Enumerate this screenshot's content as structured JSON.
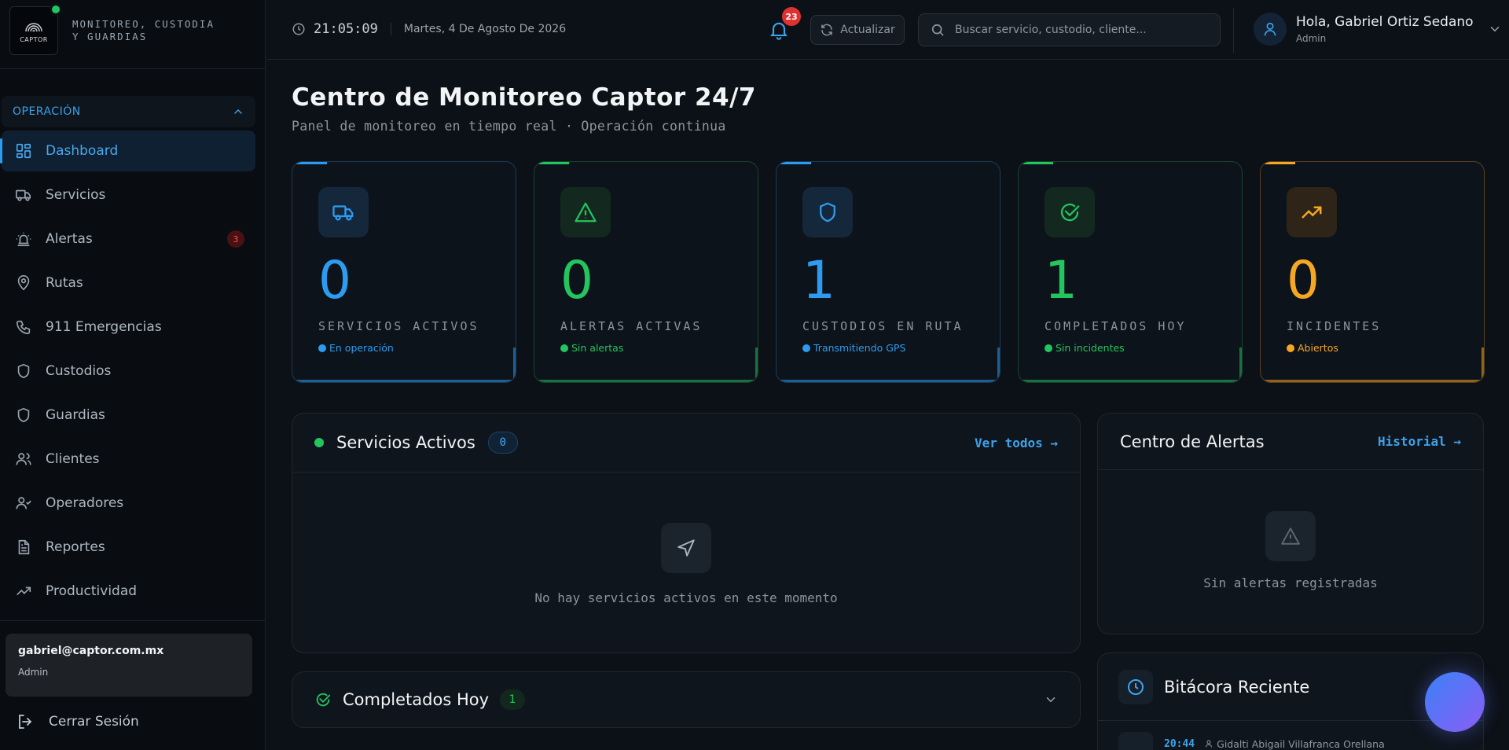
{
  "brand": {
    "logo_text": "CAPTOR",
    "title_line1": "MONITOREO, CUSTODIA",
    "title_line2": "Y GUARDIAS"
  },
  "sidebar": {
    "section_label": "OPERACIÓN",
    "items": [
      {
        "label": "Dashboard",
        "icon": "dashboard-icon",
        "active": true
      },
      {
        "label": "Servicios",
        "icon": "truck-icon"
      },
      {
        "label": "Alertas",
        "icon": "siren-icon",
        "badge": "3"
      },
      {
        "label": "Rutas",
        "icon": "map-pin-icon"
      },
      {
        "label": "911 Emergencias",
        "icon": "phone-icon"
      },
      {
        "label": "Custodios",
        "icon": "shield-icon"
      },
      {
        "label": "Guardias",
        "icon": "shield-icon"
      },
      {
        "label": "Clientes",
        "icon": "users-icon"
      },
      {
        "label": "Operadores",
        "icon": "user-check-icon"
      },
      {
        "label": "Reportes",
        "icon": "file-text-icon"
      },
      {
        "label": "Productividad",
        "icon": "trending-up-icon"
      }
    ],
    "user": {
      "email": "gabriel@captor.com.mx",
      "role": "Admin"
    },
    "logout_label": "Cerrar Sesión"
  },
  "header": {
    "time": "21:05:09",
    "date": "Martes, 4 De Agosto De 2026",
    "notifications": "23",
    "refresh_label": "Actualizar",
    "search_placeholder": "Buscar servicio, custodio, cliente...",
    "greeting": "Hola, Gabriel Ortiz Sedano",
    "role": "Admin"
  },
  "page": {
    "title": "Centro de Monitoreo Captor 24/7",
    "subtitle": "Panel de monitoreo en tiempo real · Operación continua"
  },
  "stats": [
    {
      "value": "0",
      "label": "SERVICIOS ACTIVOS",
      "sub": "En operación",
      "color": "#2d9cf0",
      "icon": "truck-icon"
    },
    {
      "value": "0",
      "label": "ALERTAS ACTIVAS",
      "sub": "Sin alertas",
      "color": "#22c55e",
      "icon": "alert-triangle-icon"
    },
    {
      "value": "1",
      "label": "CUSTODIOS EN RUTA",
      "sub": "Transmitiendo GPS",
      "color": "#2d9cf0",
      "icon": "shield-icon"
    },
    {
      "value": "1",
      "label": "COMPLETADOS HOY",
      "sub": "Sin incidentes",
      "color": "#22c55e",
      "icon": "check-circle-icon"
    },
    {
      "value": "0",
      "label": "INCIDENTES",
      "sub": "Abiertos",
      "color": "#f5a623",
      "icon": "trending-up-icon"
    }
  ],
  "servicios": {
    "title": "Servicios Activos",
    "count": "0",
    "link": "Ver todos →",
    "empty": "No hay servicios activos en este momento"
  },
  "alertas": {
    "title": "Centro de Alertas",
    "link": "Historial →",
    "empty": "Sin alertas registradas"
  },
  "completados": {
    "title": "Completados Hoy",
    "count": "1"
  },
  "bitacora": {
    "title": "Bitácora Reciente",
    "entries": [
      {
        "time": "20:44",
        "person": "Gidalti Abigail Villafranca Orellana"
      }
    ]
  }
}
